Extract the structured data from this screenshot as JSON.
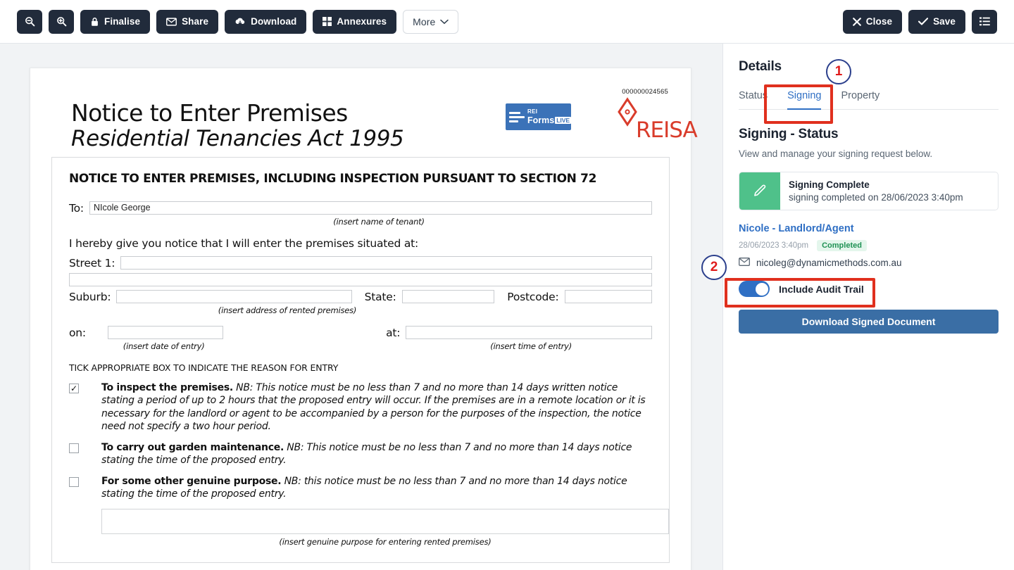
{
  "toolbar": {
    "left_buttons": [
      {
        "label": "",
        "icon": "zoom-out-icon",
        "name": "zoom-out-button"
      },
      {
        "label": "",
        "icon": "zoom-in-icon",
        "name": "zoom-in-button"
      },
      {
        "label": "Finalise",
        "icon": "lock-icon",
        "name": "finalise-button"
      },
      {
        "label": "Share",
        "icon": "envelope-icon",
        "name": "share-button"
      },
      {
        "label": "Download",
        "icon": "cloud-download-icon",
        "name": "download-button"
      },
      {
        "label": "Annexures",
        "icon": "grid-icon",
        "name": "annexures-button"
      },
      {
        "label": "More",
        "icon": "chevron-down-icon",
        "name": "more-button"
      }
    ],
    "right_buttons": [
      {
        "label": "Close",
        "icon": "close-icon",
        "name": "close-button"
      },
      {
        "label": "Save",
        "icon": "check-icon",
        "name": "save-button"
      },
      {
        "label": "",
        "icon": "list-icon",
        "name": "list-menu-button"
      }
    ],
    "dark_color": "#212b3b"
  },
  "document": {
    "doc_number": "000000024565",
    "title": "Notice to Enter Premises",
    "subtitle": "Residential Tenancies Act 1995",
    "logo_rei_line1": "REI",
    "logo_rei_line2": "Forms",
    "logo_rei_badge": "LIVE",
    "logo_reisa": "REISA",
    "section_heading": "NOTICE TO ENTER PREMISES, INCLUDING INSPECTION PURSUANT TO SECTION 72",
    "to_label": "To:",
    "to_value": "NIcole George",
    "to_hint": "(insert name of tenant)",
    "intro": "I hereby give you notice that I will enter the premises situated at:",
    "street1_label": "Street 1:",
    "street1_value": "",
    "street2_value": "",
    "suburb_label": "Suburb:",
    "suburb_value": "",
    "state_label": "State:",
    "state_value": "",
    "postcode_label": "Postcode:",
    "postcode_value": "",
    "address_hint": "(insert address of rented premises)",
    "on_label": "on:",
    "on_value": "",
    "on_hint": "(insert date of entry)",
    "at_label": "at:",
    "at_value": "",
    "at_hint": "(insert time of entry)",
    "tick_heading": "TICK APPROPRIATE BOX TO INDICATE THE REASON FOR ENTRY",
    "options": [
      {
        "checked": true,
        "check_glyph": "✓",
        "bold": "To inspect the premises.",
        "italic": " NB: This notice must be no less than 7 and no more than 14 days written notice stating a period of up to 2 hours that the proposed entry will occur. If the premises are in a remote location or it is necessary for the landlord or agent to be accompanied by a person for the purposes of the inspection, the notice need not specify a two hour period."
      },
      {
        "checked": false,
        "check_glyph": "",
        "bold": "To carry out garden maintenance.",
        "italic": " NB: This notice must be no less than 7 and no more than 14 days notice stating the time of the proposed entry."
      },
      {
        "checked": false,
        "check_glyph": "",
        "bold": "For some other genuine purpose.",
        "italic": " NB: this notice must be no less than 7 and no more than 14 days notice stating the time of the proposed entry."
      }
    ],
    "purpose_value": "",
    "purpose_hint": "(insert genuine purpose for entering rented premises)"
  },
  "panel": {
    "title": "Details",
    "tabs": [
      {
        "label": "Status",
        "active": false
      },
      {
        "label": "Signing",
        "active": true
      },
      {
        "label": "Property",
        "active": false
      }
    ],
    "section_title": "Signing - Status",
    "section_desc": "View and manage your signing request below.",
    "status_card": {
      "icon": "pencil-icon",
      "heading": "Signing Complete",
      "subtext": "signing completed on 28/06/2023 3:40pm",
      "accent_color": "#4fc18a"
    },
    "signer": {
      "name": "Nicole - Landlord/Agent",
      "date": "28/06/2023 3:40pm",
      "status_chip": "Completed",
      "email_icon": "envelope-icon",
      "email": "nicoleg@dynamicmethods.com.au"
    },
    "audit_toggle": {
      "label": "Include Audit Trail",
      "on": true
    },
    "download_button": "Download Signed Document",
    "accent_blue": "#2f6fc4",
    "button_blue": "#3a6ea5"
  },
  "annotations": [
    {
      "number": "1",
      "target": "signing-tab"
    },
    {
      "number": "2",
      "target": "include-audit-trail-toggle"
    }
  ]
}
